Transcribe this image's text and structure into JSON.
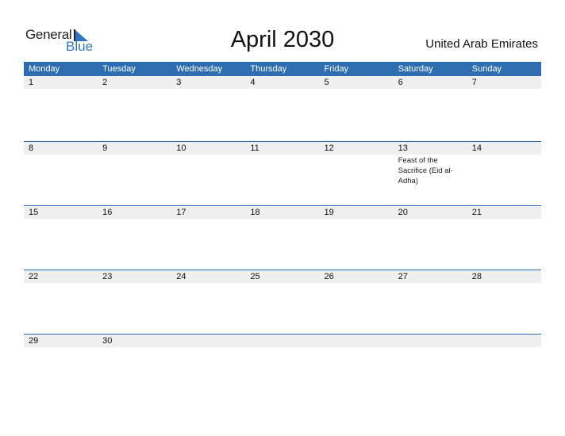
{
  "brand": {
    "part1": "General",
    "part2": "Blue"
  },
  "title": "April 2030",
  "country": "United Arab Emirates",
  "colors": {
    "header": "#2e6db0",
    "date_strip": "#efefef"
  },
  "weekdays": [
    "Monday",
    "Tuesday",
    "Wednesday",
    "Thursday",
    "Friday",
    "Saturday",
    "Sunday"
  ],
  "weeks": [
    {
      "days": [
        "1",
        "2",
        "3",
        "4",
        "5",
        "6",
        "7"
      ],
      "events": [
        "",
        "",
        "",
        "",
        "",
        "",
        ""
      ]
    },
    {
      "days": [
        "8",
        "9",
        "10",
        "11",
        "12",
        "13",
        "14"
      ],
      "events": [
        "",
        "",
        "",
        "",
        "",
        "Feast of the Sacrifice (Eid al-Adha)",
        ""
      ]
    },
    {
      "days": [
        "15",
        "16",
        "17",
        "18",
        "19",
        "20",
        "21"
      ],
      "events": [
        "",
        "",
        "",
        "",
        "",
        "",
        ""
      ]
    },
    {
      "days": [
        "22",
        "23",
        "24",
        "25",
        "26",
        "27",
        "28"
      ],
      "events": [
        "",
        "",
        "",
        "",
        "",
        "",
        ""
      ]
    },
    {
      "days": [
        "29",
        "30",
        "",
        "",
        "",
        "",
        ""
      ],
      "events": [
        "",
        "",
        "",
        "",
        "",
        "",
        ""
      ]
    }
  ]
}
